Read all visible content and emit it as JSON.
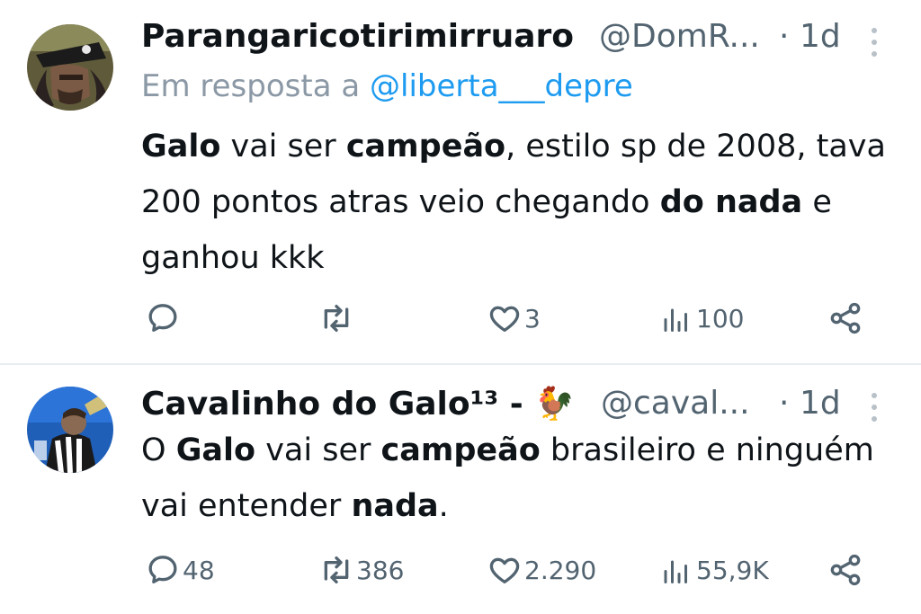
{
  "tweets": [
    {
      "display_name": "Parangaricotirimirruaro",
      "handle": "@DomR...",
      "separator": "·",
      "time": "1d",
      "reply_prefix": "Em resposta a",
      "reply_mention": "@liberta___depre",
      "body_segments": [
        {
          "text": "Galo",
          "bold": true
        },
        {
          "text": " vai ser ",
          "bold": false
        },
        {
          "text": "campeão",
          "bold": true
        },
        {
          "text": ", estilo sp de 2008, tava 200 pontos atras veio chegando ",
          "bold": false
        },
        {
          "text": "do nada",
          "bold": true
        },
        {
          "text": " e ganhou kkk",
          "bold": false
        }
      ],
      "replies": "",
      "reposts": "",
      "likes": "3",
      "views": "100"
    },
    {
      "display_name": "Cavalinho do Galo¹³ -",
      "name_emoji": "🐓",
      "handle": "@caval...",
      "separator": "·",
      "time": "1d",
      "body_segments": [
        {
          "text": "O ",
          "bold": false
        },
        {
          "text": "Galo",
          "bold": true
        },
        {
          "text": " vai ser ",
          "bold": false
        },
        {
          "text": "campeão",
          "bold": true
        },
        {
          "text": " brasileiro e ninguém vai entender ",
          "bold": false
        },
        {
          "text": "nada",
          "bold": true
        },
        {
          "text": ".",
          "bold": false
        }
      ],
      "replies": "48",
      "reposts": "386",
      "likes": "2.290",
      "views": "55,9K"
    }
  ],
  "icons": {
    "reply": "reply-icon",
    "repost": "repost-icon",
    "like": "heart-icon",
    "views": "views-icon",
    "share": "share-icon",
    "more": "more-vertical-icon"
  },
  "colors": {
    "text": "#0f1419",
    "muted": "#536471",
    "link": "#1d9bf0",
    "divider": "#e6ecf0"
  }
}
